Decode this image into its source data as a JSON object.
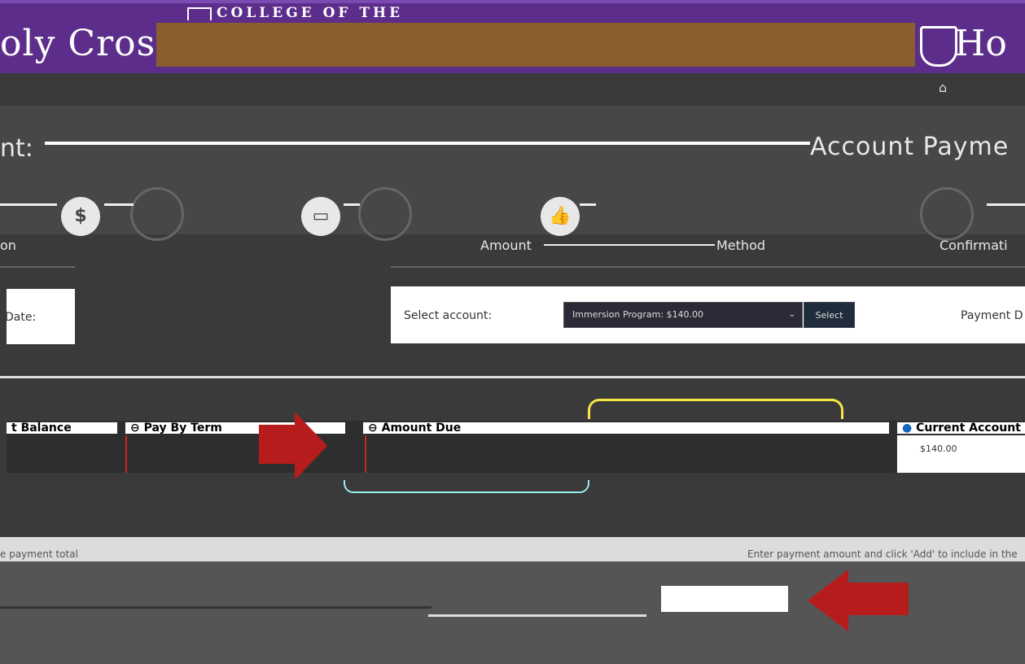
{
  "header": {
    "college_line": "COLLEGE OF THE",
    "holy_cross_left": "oly Cross",
    "holy_cross_right": "Ho"
  },
  "title": {
    "left": "nt:",
    "right": "Account Payme"
  },
  "steps": {
    "left_label": "on",
    "amount_label": "Amount",
    "method_label": "Method",
    "confirmation_label": "Confirmati"
  },
  "icons": {
    "dollar": "$",
    "card": "▭",
    "thumb": "👍"
  },
  "account": {
    "date_label": "Date:",
    "select_label": "Select account:",
    "selected_option": "Immersion Program: $140.00",
    "select_button": "Select",
    "payment_date_label": "Payment D"
  },
  "table": {
    "balance_header": "t Balance",
    "pay_by_term_header": "Pay By Term",
    "pay_by_term_value": "",
    "amount_due_header": "Amount Due",
    "amount_due_value": "",
    "current_account_header": "Current Account",
    "current_account_value": "$140.00"
  },
  "payment": {
    "total_label": "e payment total",
    "instructions": "Enter payment amount and click 'Add' to include in the"
  }
}
